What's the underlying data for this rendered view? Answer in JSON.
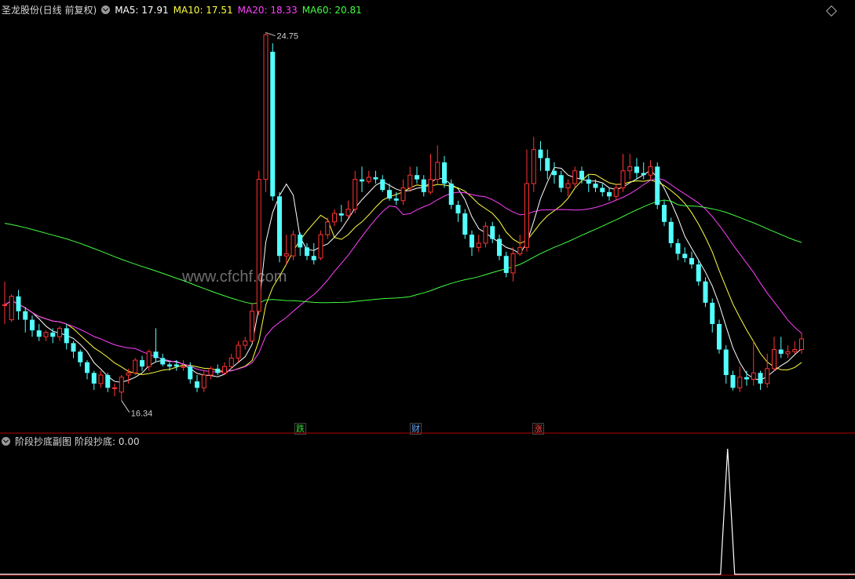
{
  "header": {
    "title": "圣龙股份(日线 前复权)",
    "ma": [
      {
        "label": "MA5: 17.91",
        "color": "#ffffff"
      },
      {
        "label": "MA10: 17.51",
        "color": "#ffff40"
      },
      {
        "label": "MA20: 18.33",
        "color": "#ff40ff"
      },
      {
        "label": "MA60: 20.81",
        "color": "#40ff40"
      }
    ]
  },
  "sub_header": {
    "title": "阶段抄底副图",
    "indicator": "阶段抄底: 0.00"
  },
  "watermark": "www.cfchf.com",
  "event_tags": [
    {
      "text": "跌",
      "color": "#33dd33"
    },
    {
      "text": "财",
      "color": "#66aaff"
    },
    {
      "text": "涨",
      "color": "#ff4444"
    }
  ],
  "colors": {
    "up": "#ff3333",
    "down": "#54ffff",
    "ma5": "#ffffff",
    "ma10": "#ffff40",
    "ma20": "#ff40ff",
    "ma60": "#40ff40",
    "divider": "#b00000"
  },
  "chart_data": [
    {
      "type": "candlestick",
      "title": "圣龙股份(日线 前复权)",
      "annotations": {
        "high_label": "24.75",
        "low_label": "16.34"
      },
      "ohlc": [
        [
          18.35,
          18.35,
          18.9,
          17.9
        ],
        [
          18.0,
          18.55,
          18.6,
          17.95
        ],
        [
          18.55,
          18.2,
          18.7,
          18.0
        ],
        [
          18.2,
          18.0,
          18.3,
          17.7
        ],
        [
          18.0,
          17.75,
          18.1,
          17.6
        ],
        [
          17.75,
          17.6,
          17.9,
          17.5
        ],
        [
          17.6,
          17.7,
          17.75,
          17.5
        ],
        [
          17.7,
          17.6,
          17.8,
          17.45
        ],
        [
          17.6,
          17.8,
          17.85,
          17.5
        ],
        [
          17.8,
          17.45,
          17.9,
          17.3
        ],
        [
          17.45,
          17.25,
          17.5,
          17.1
        ],
        [
          17.25,
          17.0,
          17.3,
          16.9
        ],
        [
          17.0,
          16.75,
          17.05,
          16.6
        ],
        [
          16.75,
          16.5,
          16.8,
          16.35
        ],
        [
          16.5,
          16.7,
          16.8,
          16.4
        ],
        [
          16.7,
          16.4,
          16.75,
          16.3
        ],
        [
          16.4,
          16.4,
          16.5,
          16.2
        ],
        [
          16.3,
          16.65,
          16.7,
          16.1
        ],
        [
          16.7,
          16.75,
          16.85,
          16.5
        ],
        [
          16.75,
          17.05,
          17.1,
          16.7
        ],
        [
          17.05,
          16.9,
          17.15,
          16.8
        ],
        [
          16.9,
          17.25,
          17.3,
          16.8
        ],
        [
          17.25,
          17.1,
          17.8,
          17.0
        ],
        [
          17.1,
          16.95,
          17.2,
          16.9
        ],
        [
          16.95,
          16.9,
          17.0,
          16.8
        ],
        [
          16.95,
          16.9,
          17.05,
          16.8
        ],
        [
          16.9,
          16.9,
          17.05,
          16.8
        ],
        [
          16.9,
          16.6,
          17.0,
          16.5
        ],
        [
          16.55,
          16.4,
          16.7,
          16.3
        ],
        [
          16.4,
          16.7,
          16.8,
          16.3
        ],
        [
          16.7,
          16.85,
          16.9,
          16.6
        ],
        [
          16.85,
          16.75,
          16.95,
          16.7
        ],
        [
          16.75,
          16.9,
          17.0,
          16.7
        ],
        [
          16.9,
          17.1,
          17.2,
          16.85
        ],
        [
          17.1,
          17.4,
          17.5,
          17.0
        ],
        [
          17.4,
          17.5,
          17.6,
          17.3
        ],
        [
          17.5,
          18.2,
          18.4,
          17.45
        ],
        [
          18.2,
          21.3,
          21.5,
          18.1
        ],
        [
          21.3,
          24.7,
          24.75,
          21.0
        ],
        [
          24.3,
          20.9,
          24.5,
          20.8
        ],
        [
          20.9,
          19.5,
          21.0,
          19.35
        ],
        [
          19.5,
          19.55,
          20.0,
          19.3
        ],
        [
          19.5,
          20.0,
          20.1,
          19.4
        ],
        [
          20.0,
          19.7,
          20.05,
          19.5
        ],
        [
          19.7,
          19.5,
          19.8,
          19.4
        ],
        [
          19.5,
          19.4,
          19.8,
          19.3
        ],
        [
          19.45,
          20.0,
          20.1,
          19.4
        ],
        [
          20.0,
          20.3,
          20.4,
          19.9
        ],
        [
          20.3,
          20.5,
          20.6,
          20.2
        ],
        [
          20.5,
          20.45,
          20.7,
          20.3
        ],
        [
          20.45,
          20.6,
          20.8,
          20.4
        ],
        [
          20.6,
          21.3,
          21.5,
          20.5
        ],
        [
          21.3,
          21.25,
          21.6,
          21.0
        ],
        [
          21.25,
          21.35,
          21.5,
          21.2
        ],
        [
          21.35,
          21.3,
          21.5,
          21.2
        ],
        [
          21.3,
          21.05,
          21.4,
          21.0
        ],
        [
          21.05,
          20.85,
          21.2,
          20.8
        ],
        [
          20.85,
          20.8,
          21.0,
          20.7
        ],
        [
          20.8,
          21.1,
          21.3,
          20.7
        ],
        [
          21.1,
          21.4,
          21.6,
          21.0
        ],
        [
          21.4,
          21.3,
          21.6,
          21.2
        ],
        [
          21.3,
          21.0,
          21.4,
          20.9
        ],
        [
          21.0,
          21.3,
          21.9,
          20.95
        ],
        [
          21.3,
          21.7,
          22.1,
          21.2
        ],
        [
          21.7,
          21.2,
          21.85,
          21.1
        ],
        [
          21.2,
          20.7,
          21.3,
          20.6
        ],
        [
          20.7,
          20.5,
          20.8,
          20.3
        ],
        [
          20.5,
          20.0,
          20.6,
          19.9
        ],
        [
          20.0,
          19.7,
          20.1,
          19.5
        ],
        [
          19.7,
          19.8,
          20.0,
          19.6
        ],
        [
          19.8,
          20.2,
          20.3,
          19.7
        ],
        [
          20.2,
          19.9,
          20.3,
          19.8
        ],
        [
          19.9,
          19.5,
          20.0,
          19.4
        ],
        [
          19.5,
          19.1,
          19.6,
          19.0
        ],
        [
          19.1,
          19.55,
          19.7,
          18.9
        ],
        [
          19.55,
          19.7,
          20.0,
          19.5
        ],
        [
          19.7,
          21.2,
          22.0,
          19.6
        ],
        [
          21.2,
          22.0,
          22.3,
          21.0
        ],
        [
          22.0,
          21.8,
          22.2,
          21.5
        ],
        [
          21.8,
          21.5,
          22.0,
          21.3
        ],
        [
          21.5,
          21.4,
          21.7,
          21.2
        ],
        [
          21.4,
          21.1,
          21.5,
          21.0
        ],
        [
          21.1,
          21.2,
          21.3,
          20.9
        ],
        [
          21.2,
          21.5,
          21.6,
          21.1
        ],
        [
          21.5,
          21.3,
          21.6,
          21.2
        ],
        [
          21.3,
          21.2,
          21.4,
          21.0
        ],
        [
          21.2,
          21.1,
          21.3,
          21.0
        ],
        [
          21.1,
          21.0,
          21.2,
          20.9
        ],
        [
          21.0,
          20.9,
          21.1,
          20.8
        ],
        [
          20.9,
          21.1,
          21.2,
          20.8
        ],
        [
          21.1,
          21.5,
          21.9,
          21.0
        ],
        [
          21.5,
          21.6,
          21.9,
          21.3
        ],
        [
          21.6,
          21.45,
          21.8,
          21.3
        ],
        [
          21.45,
          21.4,
          21.7,
          21.3
        ],
        [
          21.4,
          21.6,
          21.75,
          21.3
        ],
        [
          21.6,
          20.7,
          21.7,
          20.6
        ],
        [
          20.7,
          20.3,
          20.8,
          20.2
        ],
        [
          20.3,
          19.8,
          20.4,
          19.7
        ],
        [
          19.8,
          19.55,
          19.9,
          19.4
        ],
        [
          19.55,
          19.45,
          19.7,
          19.35
        ],
        [
          19.45,
          19.3,
          19.6,
          19.2
        ],
        [
          19.3,
          18.9,
          19.4,
          18.8
        ],
        [
          18.9,
          18.4,
          19.0,
          18.3
        ],
        [
          18.4,
          17.9,
          18.5,
          17.7
        ],
        [
          17.9,
          17.3,
          18.0,
          17.2
        ],
        [
          17.3,
          16.7,
          17.4,
          16.5
        ],
        [
          16.7,
          16.4,
          16.8,
          16.34
        ],
        [
          16.4,
          16.65,
          16.9,
          16.3
        ],
        [
          16.65,
          16.6,
          16.8,
          16.45
        ],
        [
          16.6,
          16.75,
          17.5,
          16.45
        ],
        [
          16.75,
          16.5,
          16.8,
          16.35
        ],
        [
          16.5,
          16.85,
          17.2,
          16.4
        ],
        [
          16.85,
          17.3,
          17.6,
          16.8
        ],
        [
          17.3,
          17.2,
          17.6,
          17.1
        ],
        [
          17.2,
          17.25,
          17.4,
          17.1
        ],
        [
          17.25,
          17.3,
          17.5,
          17.2
        ],
        [
          17.3,
          17.55,
          17.7,
          17.2
        ]
      ],
      "ma_lines": [
        "MA5",
        "MA10",
        "MA20",
        "MA60"
      ],
      "ylim": [
        16.0,
        25.0
      ]
    },
    {
      "type": "line",
      "title": "阶段抄底副图",
      "series": [
        {
          "name": "阶段抄底",
          "spike_index": 105,
          "spike_value": 1.0
        }
      ],
      "ylim": [
        0,
        1.0
      ]
    }
  ]
}
